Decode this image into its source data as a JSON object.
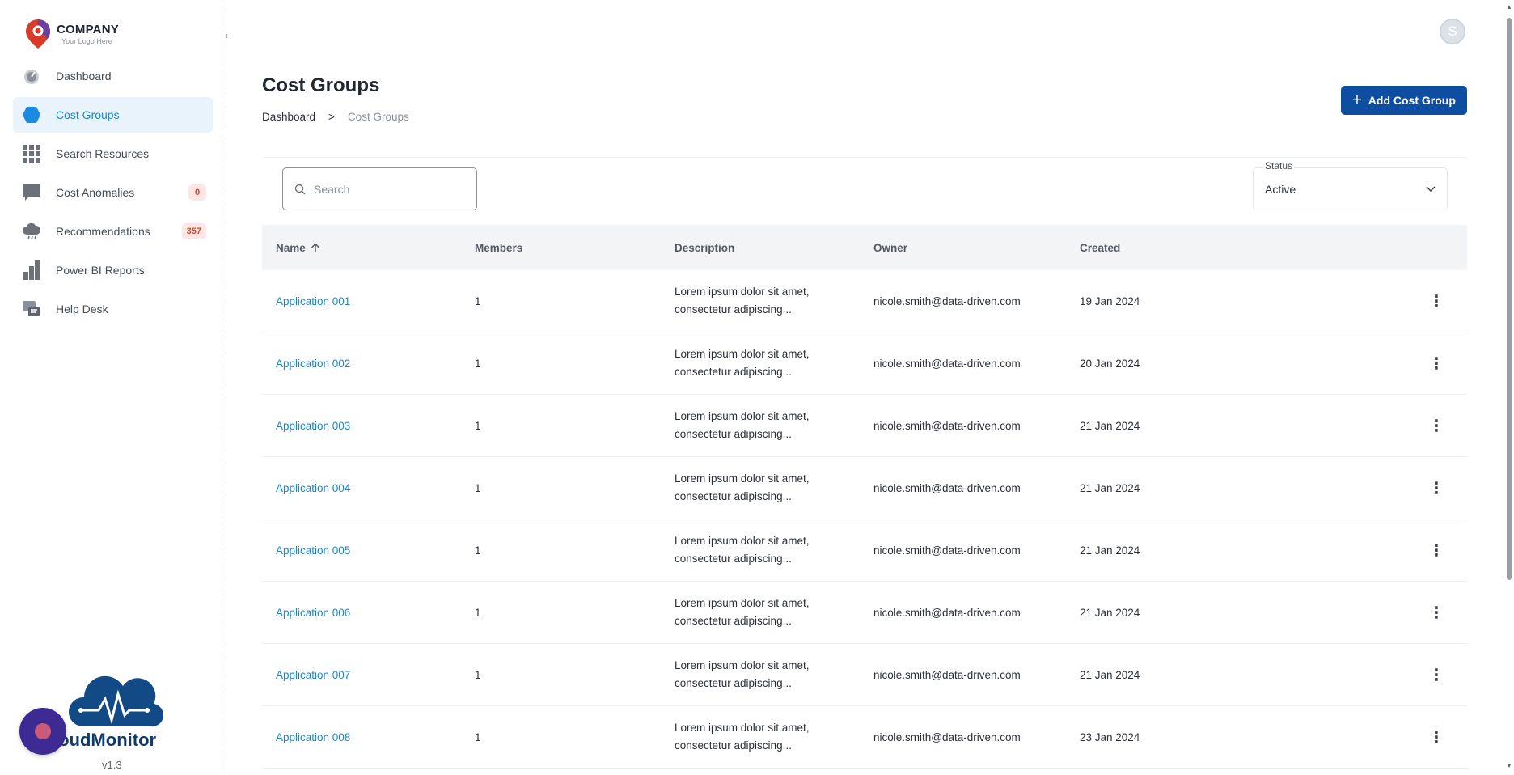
{
  "company": {
    "name": "COMPANY",
    "tagline": "Your Logo Here"
  },
  "sidebar": {
    "items": [
      {
        "label": "Dashboard",
        "icon": "gauge-icon",
        "active": false,
        "badge": null
      },
      {
        "label": "Cost Groups",
        "icon": "hexagon-icon",
        "active": true,
        "badge": null
      },
      {
        "label": "Search Resources",
        "icon": "grid-icon",
        "active": false,
        "badge": null
      },
      {
        "label": "Cost Anomalies",
        "icon": "chat-icon",
        "active": false,
        "badge": "0"
      },
      {
        "label": "Recommendations",
        "icon": "cloud-icon",
        "active": false,
        "badge": "357"
      },
      {
        "label": "Power BI Reports",
        "icon": "bar-chart-icon",
        "active": false,
        "badge": null
      },
      {
        "label": "Help Desk",
        "icon": "help-desk-icon",
        "active": false,
        "badge": null
      }
    ],
    "collapse_icon": "chevron-left-icon"
  },
  "brand": {
    "name": "loudMonitor",
    "version": "v1.3"
  },
  "user": {
    "initial": "S"
  },
  "page": {
    "title": "Cost Groups",
    "breadcrumb": {
      "root": "Dashboard",
      "separator": ">",
      "current": "Cost Groups"
    },
    "add_button": "Add Cost Group"
  },
  "search": {
    "placeholder": "Search"
  },
  "status_filter": {
    "label": "Status",
    "value": "Active"
  },
  "table": {
    "columns": {
      "name": "Name",
      "members": "Members",
      "description": "Description",
      "owner": "Owner",
      "created": "Created"
    },
    "rows": [
      {
        "name": "Application 001",
        "members": "1",
        "desc1": "Lorem ipsum dolor sit amet,",
        "desc2": "consectetur adipiscing...",
        "owner": "nicole.smith@data-driven.com",
        "created": "19 Jan 2024"
      },
      {
        "name": "Application 002",
        "members": "1",
        "desc1": "Lorem ipsum dolor sit amet,",
        "desc2": "consectetur adipiscing...",
        "owner": "nicole.smith@data-driven.com",
        "created": "20 Jan 2024"
      },
      {
        "name": "Application 003",
        "members": "1",
        "desc1": "Lorem ipsum dolor sit amet,",
        "desc2": "consectetur adipiscing...",
        "owner": "nicole.smith@data-driven.com",
        "created": "21 Jan 2024"
      },
      {
        "name": "Application 004",
        "members": "1",
        "desc1": "Lorem ipsum dolor sit amet,",
        "desc2": "consectetur adipiscing...",
        "owner": "nicole.smith@data-driven.com",
        "created": "21 Jan 2024"
      },
      {
        "name": "Application 005",
        "members": "1",
        "desc1": "Lorem ipsum dolor sit amet,",
        "desc2": "consectetur adipiscing...",
        "owner": "nicole.smith@data-driven.com",
        "created": "21 Jan 2024"
      },
      {
        "name": "Application 006",
        "members": "1",
        "desc1": "Lorem ipsum dolor sit amet,",
        "desc2": "consectetur adipiscing...",
        "owner": "nicole.smith@data-driven.com",
        "created": "21 Jan 2024"
      },
      {
        "name": "Application 007",
        "members": "1",
        "desc1": "Lorem ipsum dolor sit amet,",
        "desc2": "consectetur adipiscing...",
        "owner": "nicole.smith@data-driven.com",
        "created": "21 Jan 2024"
      },
      {
        "name": "Application 008",
        "members": "1",
        "desc1": "Lorem ipsum dolor sit amet,",
        "desc2": "consectetur adipiscing...",
        "owner": "nicole.smith@data-driven.com",
        "created": "23 Jan 2024"
      }
    ]
  },
  "colors": {
    "primary": "#0d4ea0",
    "link": "#1a86c8",
    "active_bg": "#e8f3fc",
    "badge_bg": "#fde6e4",
    "badge_text": "#d8412f"
  }
}
